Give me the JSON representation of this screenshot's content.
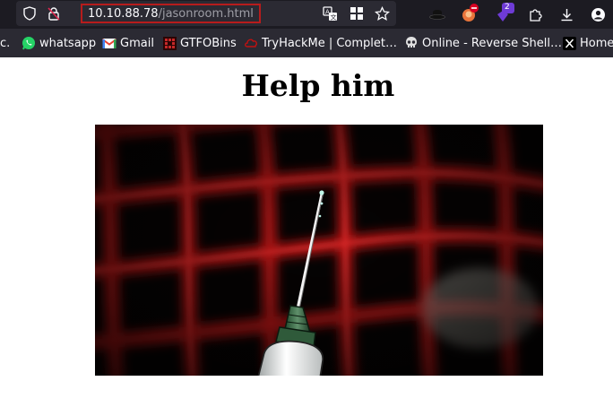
{
  "browser": {
    "url_host": "10.10.88.78",
    "url_path": "/jasonroom.html",
    "badge_count": "2"
  },
  "bookmarks": [
    {
      "label": "c.",
      "icon": "partial-bookmark"
    },
    {
      "label": "whatsapp",
      "icon": "whatsapp-icon"
    },
    {
      "label": "Gmail",
      "icon": "gmail-icon"
    },
    {
      "label": "GTFOBins",
      "icon": "gtfobins-icon"
    },
    {
      "label": "TryHackMe | Complet…",
      "icon": "tryhackme-icon"
    },
    {
      "label": "Online - Reverse Shell…",
      "icon": "skull-icon"
    },
    {
      "label": "Home",
      "icon": "x-icon"
    }
  ],
  "page": {
    "heading": "Help him"
  },
  "colors": {
    "toolbar_bg": "#1c1b22",
    "bookmarks_bg": "#2b2a33",
    "url_highlight": "#b71c1c"
  }
}
